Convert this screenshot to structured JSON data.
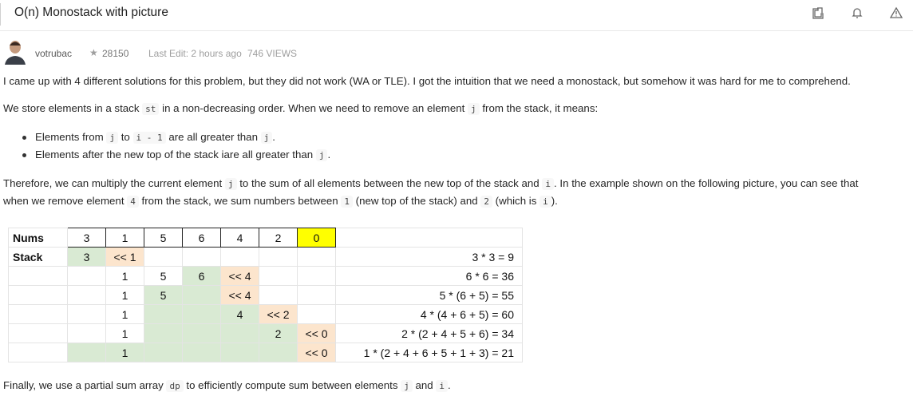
{
  "header": {
    "title": "O(n) Monostack with picture",
    "icons": [
      "share-icon",
      "bell-icon",
      "warning-icon"
    ]
  },
  "meta": {
    "author": "votrubac",
    "reputation": "28150",
    "last_edit": "Last Edit: 2 hours ago",
    "views": "746 VIEWS"
  },
  "body": {
    "p1": "I came up with 4 different solutions for this problem, but they did not work (WA or TLE). I got the intuition that we need a monostack, but somehow it was hard for me to comprehend.",
    "p2": {
      "a": "We store elements in a stack ",
      "c1": "st",
      "b": " in a non-decreasing order. When we need to remove an element ",
      "c2": "j",
      "c": " from the stack, it means:"
    },
    "bullet1": {
      "a": "Elements from ",
      "c1": "j",
      "b": " to ",
      "c2": "i - 1",
      "c": " are all greater than ",
      "c3": "j",
      "d": "."
    },
    "bullet2": {
      "a": "Elements after the new top of the stack iare all greater than ",
      "c1": "j",
      "b": "."
    },
    "p3": {
      "a": "Therefore, we can multiply the current element ",
      "c1": "j",
      "b": " to the sum of all elements between the new top of the stack and ",
      "c2": "i",
      "c": ". In the example shown on the following picture, you can see that"
    },
    "p3b": {
      "a": "when we remove element ",
      "c1": "4",
      "b": " from the stack, we sum numbers between ",
      "c2": "1",
      "c": " (new top of the stack) and ",
      "c3": "2",
      "d": " (which is ",
      "c4": "i",
      "e": ")."
    },
    "p4": {
      "a": "Finally, we use a partial sum array ",
      "c1": "dp",
      "b": " to efficiently compute sum between elements ",
      "c2": "j",
      "c": " and ",
      "c3": "i",
      "d": "."
    }
  },
  "table": {
    "nums_label": "Nums",
    "stack_label": "Stack",
    "nums": [
      "3",
      "1",
      "5",
      "6",
      "4",
      "2",
      "0"
    ],
    "rows": [
      [
        "3",
        "<< 1",
        "",
        "",
        "",
        "",
        ""
      ],
      [
        "",
        "1",
        "5",
        "6",
        "<< 4",
        "",
        ""
      ],
      [
        "",
        "1",
        "5",
        "",
        "<< 4",
        "",
        ""
      ],
      [
        "",
        "1",
        "",
        "",
        "4",
        "<< 2",
        ""
      ],
      [
        "",
        "1",
        "",
        "",
        "",
        "2",
        "<< 0"
      ],
      [
        "",
        "1",
        "",
        "",
        "",
        "",
        "<< 0"
      ]
    ],
    "results": [
      "3 * 3 = 9",
      "6 * 6 = 36",
      "5 * (6 + 5) = 55",
      "4 * (4 + 6 + 5) = 60",
      "2 * (2 + 4 + 5 + 6) = 34",
      "1 * (2 + 4 + 6 + 5 + 1 + 3) = 21"
    ]
  },
  "colors": {
    "highlight_yellow": "#ffff00",
    "stack_green": "#d9ead3",
    "pop_orange": "#fce5cd"
  }
}
